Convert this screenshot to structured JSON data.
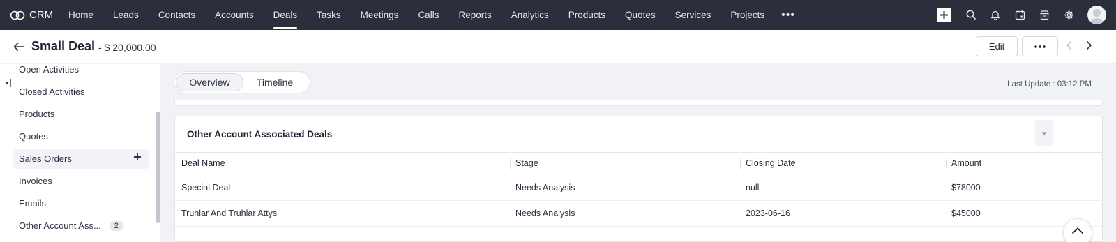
{
  "nav": {
    "brand": "CRM",
    "items": [
      {
        "label": "Home"
      },
      {
        "label": "Leads"
      },
      {
        "label": "Contacts"
      },
      {
        "label": "Accounts"
      },
      {
        "label": "Deals",
        "active": true
      },
      {
        "label": "Tasks"
      },
      {
        "label": "Meetings"
      },
      {
        "label": "Calls"
      },
      {
        "label": "Reports"
      },
      {
        "label": "Analytics"
      },
      {
        "label": "Products"
      },
      {
        "label": "Quotes"
      },
      {
        "label": "Services"
      },
      {
        "label": "Projects"
      }
    ],
    "more": "•••",
    "icons": [
      "plus-icon",
      "search-icon",
      "bell-icon",
      "calendar-icon",
      "marketplace-icon",
      "gear-icon",
      "avatar"
    ]
  },
  "record": {
    "title": "Small Deal",
    "amount": "- $ 20,000.00",
    "edit_label": "Edit",
    "more_label": "•••"
  },
  "sidebar": {
    "items": [
      {
        "label": "Open Activities"
      },
      {
        "label": "Closed Activities"
      },
      {
        "label": "Products"
      },
      {
        "label": "Quotes"
      },
      {
        "label": "Sales Orders"
      },
      {
        "label": "Invoices"
      },
      {
        "label": "Emails"
      },
      {
        "label": "Other Account Ass...",
        "badge": "2"
      }
    ]
  },
  "tabs": {
    "overview": "Overview",
    "timeline": "Timeline"
  },
  "last_update": "Last Update : 03:12 PM",
  "card": {
    "title": "Other Account Associated Deals",
    "columns": [
      "Deal Name",
      "Stage",
      "Closing Date",
      "Amount"
    ],
    "rows": [
      [
        "Special Deal",
        "Needs Analysis",
        "null",
        "$78000"
      ],
      [
        "Truhlar And Truhlar Attys",
        "Needs Analysis",
        "2023-06-16",
        "$45000"
      ]
    ]
  },
  "colors": {
    "nav_bg": "#2b2e3b",
    "page_bg": "#f1f2f6",
    "accent": "#ffffff"
  }
}
